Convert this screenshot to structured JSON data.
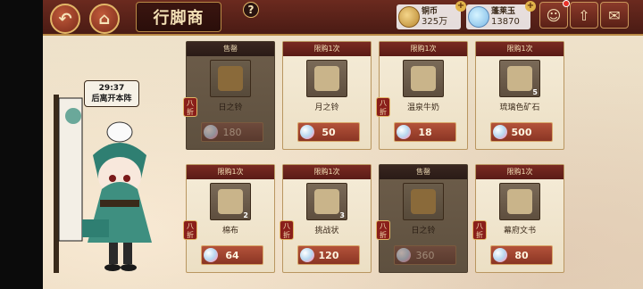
{
  "header": {
    "title": "行脚商",
    "help": "?",
    "back_icon": "back-arrow-icon",
    "home_icon": "home-icon"
  },
  "currencies": [
    {
      "name": "铜币",
      "value": "325万",
      "icon": "copper-coin-icon"
    },
    {
      "name": "蓬莱玉",
      "value": "13870",
      "icon": "jade-icon"
    }
  ],
  "right_icons": [
    "friends-icon",
    "upgrade-arrow-icon",
    "mail-icon"
  ],
  "merchant": {
    "timer": "29:37",
    "timer_note": "后离开本阵"
  },
  "discount_label": "八折",
  "cards": [
    {
      "header": "售罄",
      "name": "日之铃",
      "price": "180",
      "sold": true,
      "discount": true,
      "qty": ""
    },
    {
      "header": "限购1次",
      "name": "月之铃",
      "price": "50",
      "sold": false,
      "discount": false,
      "qty": ""
    },
    {
      "header": "限购1次",
      "name": "温泉牛奶",
      "price": "18",
      "sold": false,
      "discount": true,
      "qty": ""
    },
    {
      "header": "限购1次",
      "name": "琉璃色矿石",
      "price": "500",
      "sold": false,
      "discount": false,
      "qty": "5"
    },
    {
      "header": "限购1次",
      "name": "棉布",
      "price": "64",
      "sold": false,
      "discount": true,
      "qty": "2"
    },
    {
      "header": "限购1次",
      "name": "挑战状",
      "price": "120",
      "sold": false,
      "discount": true,
      "qty": "3"
    },
    {
      "header": "售罄",
      "name": "日之铃",
      "price": "360",
      "sold": true,
      "discount": true,
      "qty": ""
    },
    {
      "header": "限购1次",
      "name": "幕府文书",
      "price": "80",
      "sold": false,
      "discount": true,
      "qty": ""
    }
  ]
}
